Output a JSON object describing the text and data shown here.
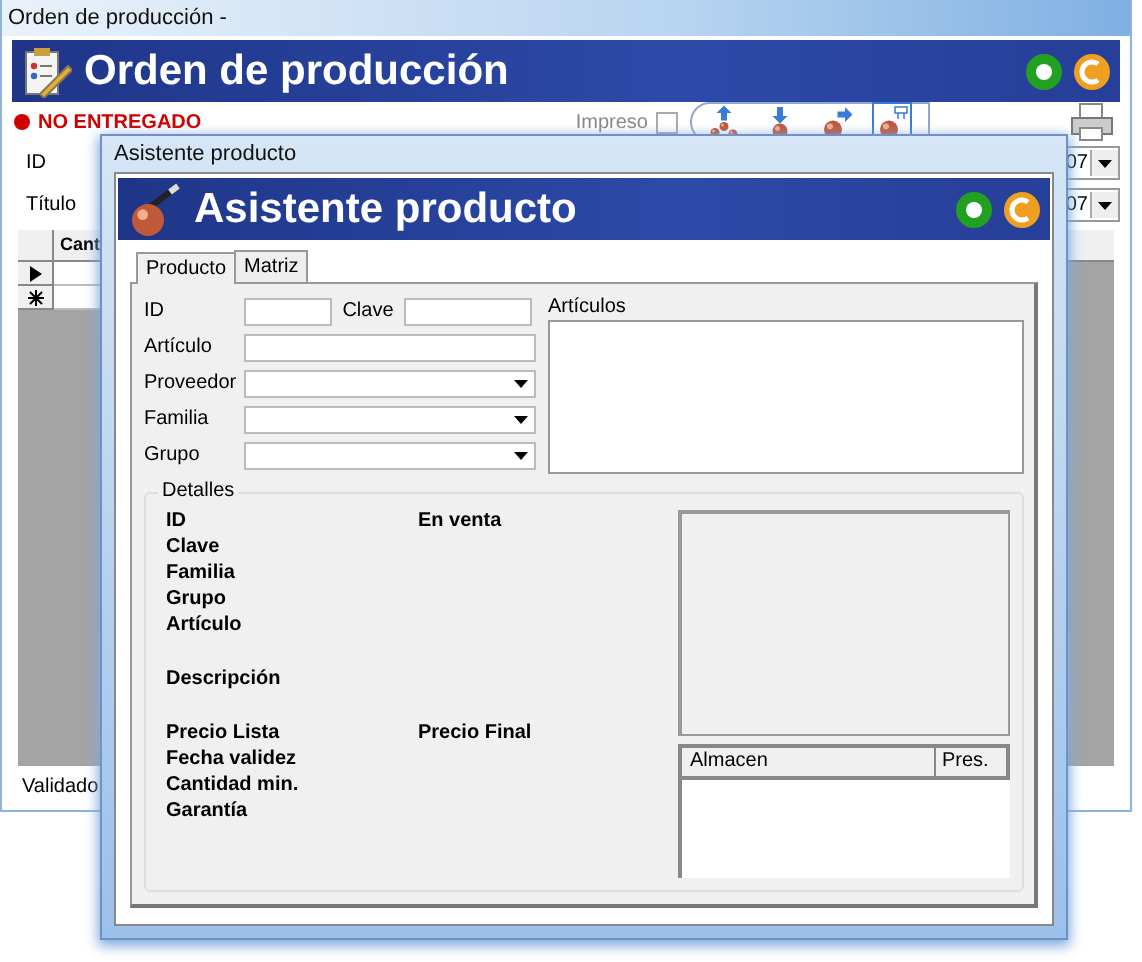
{
  "main_window": {
    "title": "Orden de producción -",
    "header_title": "Orden de producción",
    "status": {
      "text": "NO ENTREGADO",
      "color": "#d00000"
    },
    "printed": {
      "label": "Impreso",
      "checked": false
    },
    "toolbar": [
      {
        "kind": "up",
        "selected": false
      },
      {
        "kind": "down",
        "selected": false
      },
      {
        "kind": "forward",
        "selected": false
      },
      {
        "kind": "tree",
        "selected": true
      }
    ],
    "fields": [
      {
        "label": "ID",
        "value": "07"
      },
      {
        "label": "Título",
        "value": "07"
      }
    ],
    "grid": {
      "columns": [
        "Cant"
      ],
      "rows": [
        {
          "kind": "current"
        },
        {
          "kind": "new"
        }
      ]
    },
    "footer": "Validado"
  },
  "dialog": {
    "title": "Asistente producto",
    "header_title": "Asistente producto",
    "tabs": [
      {
        "label": "Producto",
        "selected": true
      },
      {
        "label": "Matriz",
        "selected": false
      }
    ],
    "form_rows": [
      [
        {
          "label": "ID",
          "kind": "short"
        },
        {
          "label": "Clave",
          "kind": "short"
        }
      ],
      [
        {
          "label": "Artículo",
          "kind": "text"
        }
      ],
      [
        {
          "label": "Proveedor",
          "kind": "combo"
        }
      ],
      [
        {
          "label": "Familia",
          "kind": "combo"
        }
      ],
      [
        {
          "label": "Grupo",
          "kind": "combo"
        }
      ]
    ],
    "list_label": "Artículos",
    "details": {
      "title": "Detalles",
      "blocks": [
        [
          [
            "ID",
            "En venta"
          ],
          [
            "Clave"
          ],
          [
            "Familia"
          ],
          [
            "Grupo"
          ],
          [
            "Artículo"
          ]
        ],
        [
          [
            "Descripción"
          ]
        ],
        [
          [
            "Precio Lista",
            "Precio Final"
          ],
          [
            "Fecha validez"
          ],
          [
            "Cantidad min."
          ],
          [
            "Garantía"
          ]
        ]
      ],
      "stock_columns": [
        "Almacen",
        "Pres."
      ]
    }
  }
}
